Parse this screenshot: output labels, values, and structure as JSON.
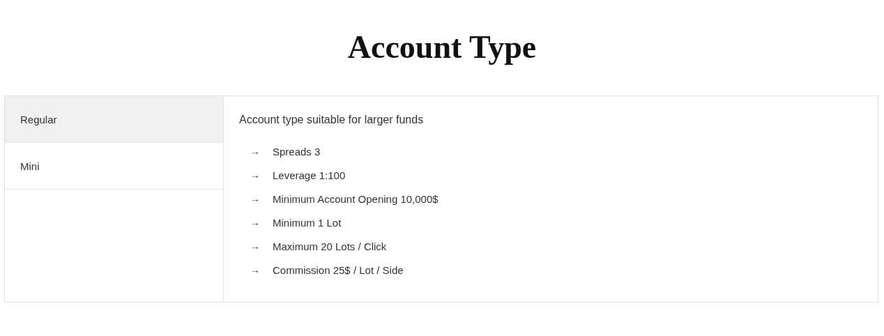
{
  "title": "Account Type",
  "tabs": [
    {
      "label": "Regular",
      "selected": true
    },
    {
      "label": "Mini",
      "selected": false
    }
  ],
  "panel": {
    "heading": "Account type suitable for larger funds",
    "items": [
      {
        "arrow": "→",
        "text": "Spreads 3"
      },
      {
        "arrow": "→",
        "text": "Leverage 1:100"
      },
      {
        "arrow": "→",
        "text": "Minimum Account Opening 10,000$"
      },
      {
        "arrow": "→",
        "text": "Minimum 1 Lot"
      },
      {
        "arrow": "→",
        "text": "Maximum 20 Lots / Click"
      },
      {
        "arrow": "→",
        "text": "Commission 25$ / Lot / Side"
      }
    ]
  }
}
